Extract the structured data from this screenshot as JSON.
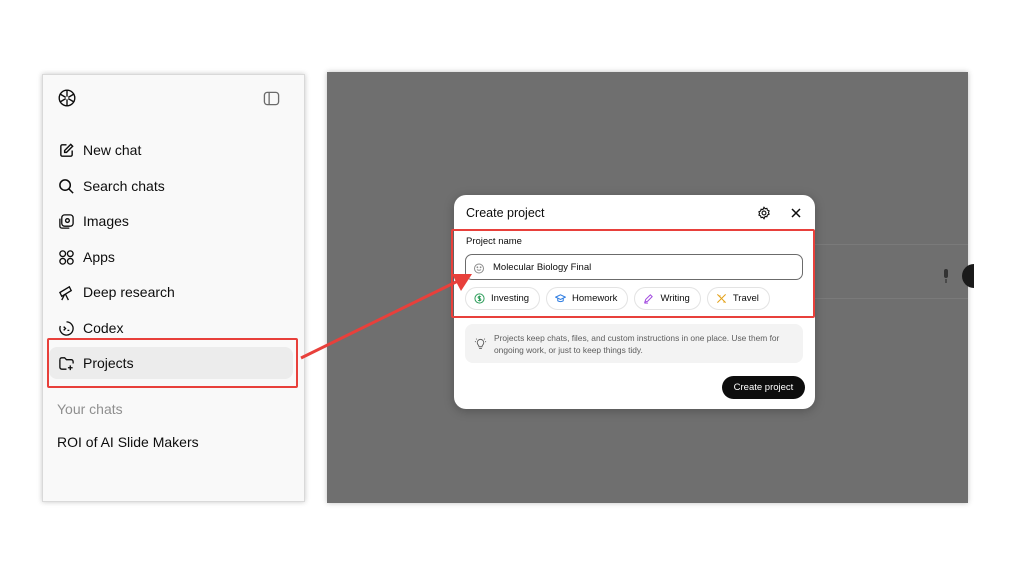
{
  "sidebar": {
    "logo_icon": "openai-logo-icon",
    "toggle_icon": "sidebar-toggle-icon",
    "items": [
      {
        "label": "New chat",
        "icon": "edit-icon"
      },
      {
        "label": "Search chats",
        "icon": "search-icon"
      },
      {
        "label": "Images",
        "icon": "images-icon"
      },
      {
        "label": "Apps",
        "icon": "apps-grid-icon"
      },
      {
        "label": "Deep research",
        "icon": "telescope-icon"
      },
      {
        "label": "Codex",
        "icon": "codex-icon"
      },
      {
        "label": "Projects",
        "icon": "folder-plus-icon"
      }
    ],
    "section_title": "Your chats",
    "chats": [
      "ROI of AI Slide Makers"
    ]
  },
  "modal": {
    "title": "Create project",
    "field_label": "Project name",
    "input_value": "Molecular Biology Final",
    "chips": [
      {
        "label": "Investing",
        "icon": "dollar-icon",
        "color": "#2e9e5b"
      },
      {
        "label": "Homework",
        "icon": "graduation-cap-icon",
        "color": "#2f7de1"
      },
      {
        "label": "Writing",
        "icon": "pen-icon",
        "color": "#a34de0"
      },
      {
        "label": "Travel",
        "icon": "airplane-icon",
        "color": "#e3a21a"
      }
    ],
    "info_text": "Projects keep chats, files, and custom instructions in one place. Use them for ongoing work, or just to keep things tidy.",
    "create_label": "Create project"
  },
  "annotation": {
    "highlight_color": "#e8403b"
  }
}
